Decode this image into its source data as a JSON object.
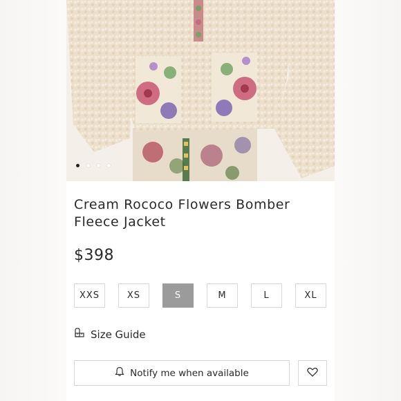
{
  "product": {
    "title": "Cream Rococo Flowers Bomber Fleece Jacket",
    "price": "$398",
    "image_alt": "photo of cream fleece bomber jacket with embroidered floral pockets",
    "carousel": {
      "total": 4,
      "active": 1
    }
  },
  "sizes": [
    {
      "label": "XXS",
      "selected": false
    },
    {
      "label": "XS",
      "selected": false
    },
    {
      "label": "S",
      "selected": true
    },
    {
      "label": "M",
      "selected": false
    },
    {
      "label": "L",
      "selected": false
    },
    {
      "label": "XL",
      "selected": false
    }
  ],
  "size_guide": {
    "label": "Size Guide",
    "icon": "ruler-icon"
  },
  "notify": {
    "label": "Notify me when available",
    "icon": "bell-icon"
  },
  "wishlist": {
    "icon": "heart-icon"
  },
  "colors": {
    "selected_size_bg": "#9b9b9b",
    "border": "#d7d7d7",
    "text": "#2a2a2a"
  }
}
